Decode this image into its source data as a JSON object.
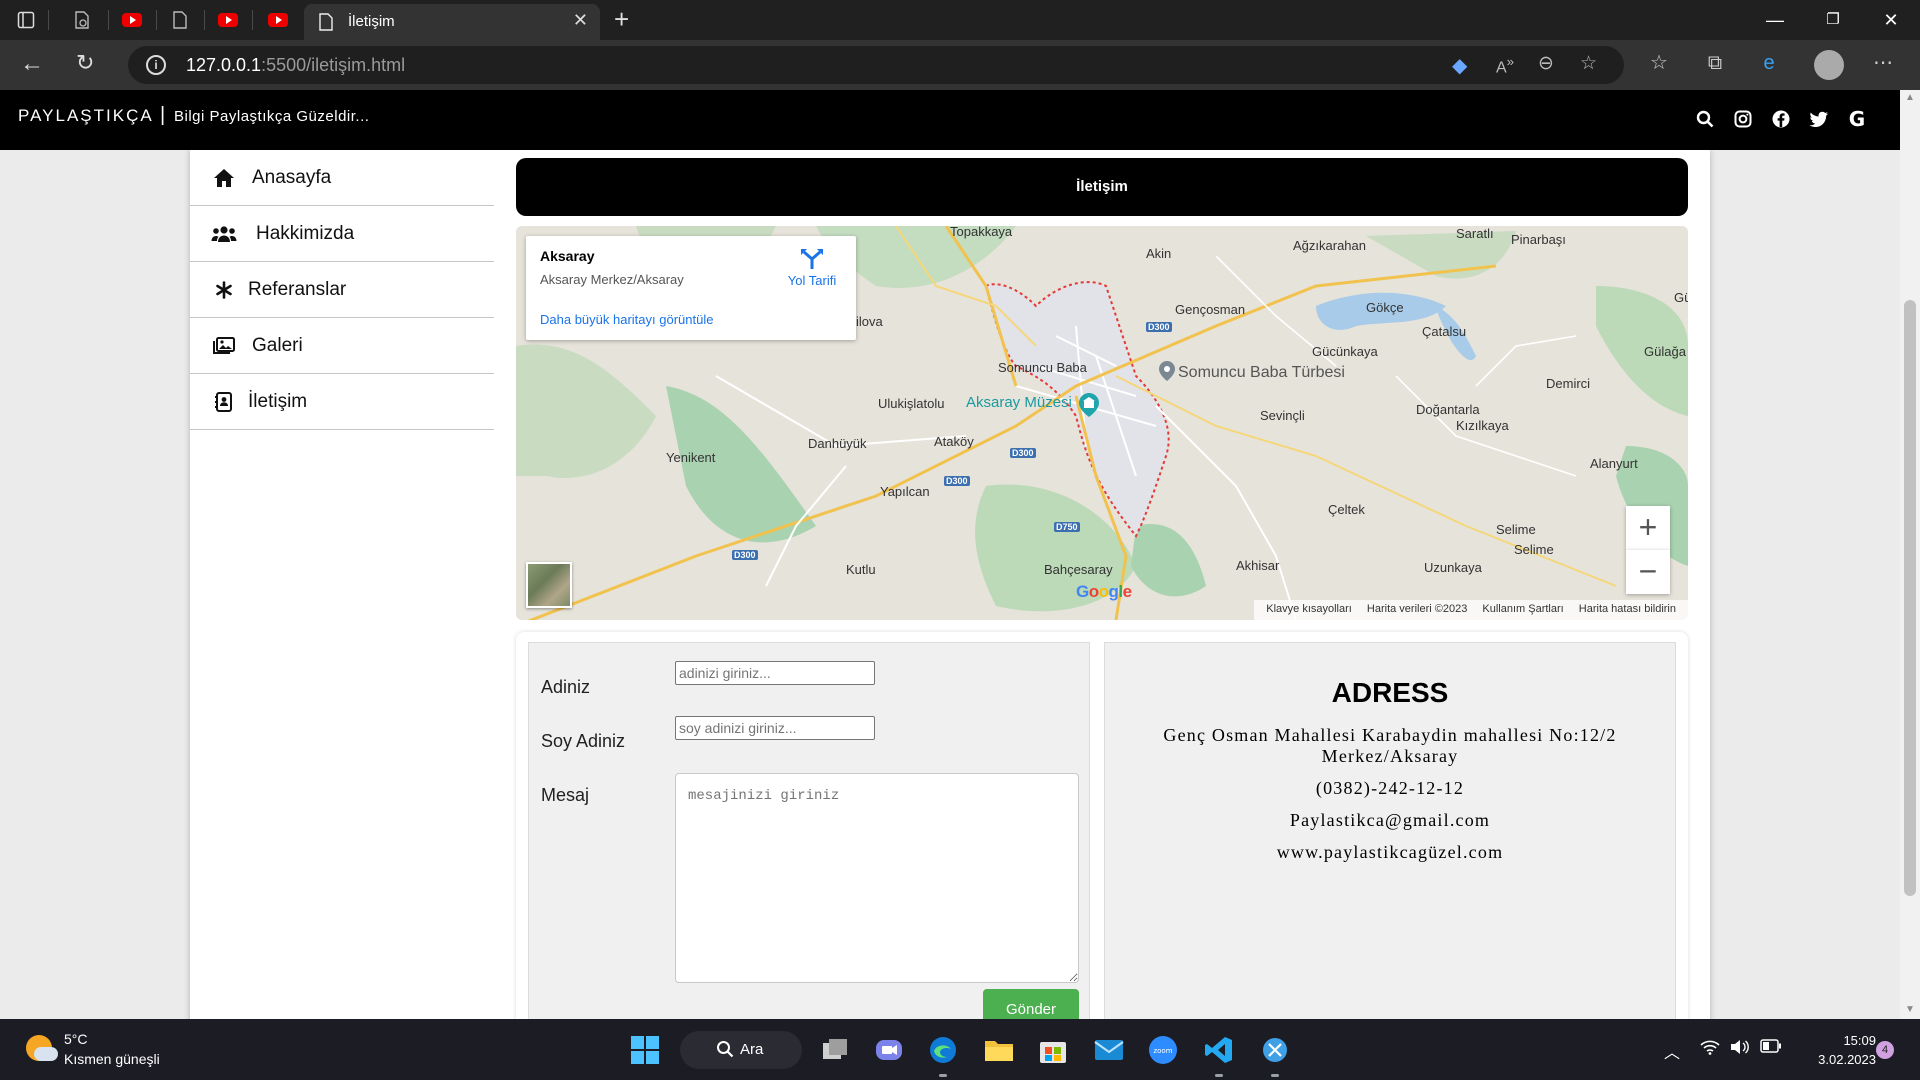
{
  "browser": {
    "active_tab_title": "İletişim",
    "url_host": "127.0.0.1",
    "url_path": ":5500/iletişim.html"
  },
  "site": {
    "brand": "PAYLAŞTIKÇA",
    "separator": "|",
    "tagline": "Bilgi Paylaştıkça Güzeldir...",
    "social_icons": [
      "search-icon",
      "instagram-icon",
      "facebook-icon",
      "twitter-icon",
      "google-icon"
    ]
  },
  "sidebar": {
    "items": [
      {
        "label": "Anasayfa",
        "icon": "home-icon"
      },
      {
        "label": "Hakkimizda",
        "icon": "users-icon"
      },
      {
        "label": "Referanslar",
        "icon": "asterisk-icon"
      },
      {
        "label": "Galeri",
        "icon": "images-icon"
      },
      {
        "label": "İletişim",
        "icon": "contact-book-icon"
      }
    ]
  },
  "page_title": "İletişim",
  "map": {
    "card": {
      "title": "Aksaray",
      "subtitle": "Aksaray Merkez/Aksaray",
      "directions": "Yol Tarifi",
      "larger_map": "Daha büyük haritayı görüntüle"
    },
    "labels": {
      "topakkaya": "Topakkaya",
      "akin": "Akin",
      "agzikarahan": "Ağzıkarahan",
      "saratli": "Saratlı",
      "pinarbasi": "Pinarbaşı",
      "gencosman": "Gençosman",
      "gokce": "Gökçe",
      "catalsu": "Çatalsu",
      "gulagac": "Gülağa",
      "gu": "Gü",
      "ilova": "ilova",
      "gucunkaya": "Gücünkaya",
      "somuncu_baba": "Somuncu Baba",
      "somuncu_baba_turbesi": "Somuncu Baba Türbesi",
      "demirci": "Demirci",
      "ulukislatolu": "Ulukişlatolu",
      "aksaray_muzesi": "Aksaray Müzesi",
      "sevincli": "Sevinçli",
      "dogantarla": "Doğantarla",
      "kizilkaya": "Kızılkaya",
      "yenikent": "Yenikent",
      "danhuyuk": "Danhüyük",
      "atakoy": "Ataköy",
      "alanyurt": "Alanyurt",
      "yapilcan": "Yapılcan",
      "celtek": "Çeltek",
      "selime1": "Selime",
      "selime2": "Selime",
      "kutlu": "Kutlu",
      "bahcesaray": "Bahçesaray",
      "akhisar": "Akhisar",
      "uzunkaya": "Uzunkaya"
    },
    "roads": {
      "r1": "D300",
      "r2": "D300",
      "r3": "D300",
      "r4": "D300",
      "r5": "D750"
    },
    "zoom_in": "+",
    "zoom_out": "−",
    "logo": "Google",
    "footer": {
      "shortcuts": "Klavye kısayolları",
      "data": "Harita verileri ©2023",
      "terms": "Kullanım Şartları",
      "report": "Harita hatası bildirin"
    }
  },
  "form": {
    "name_label": "Adiniz",
    "name_placeholder": "adinizi giriniz...",
    "surname_label": "Soy Adiniz",
    "surname_placeholder": "soy adinizi giriniz...",
    "message_label": "Mesaj",
    "message_placeholder": "mesajinizi giriniz",
    "submit": "Gönder"
  },
  "address": {
    "title": "ADRESS",
    "line1": "Genç Osman Mahallesi Karabaydin mahallesi No:12/2",
    "line2": "Merkez/Aksaray",
    "phone": "(0382)-242-12-12",
    "email": "Paylastikca@gmail.com",
    "website": "www.paylastikcagüzel.com"
  },
  "taskbar": {
    "temperature": "5°C",
    "weather": "Kısmen güneşli",
    "search_label": "Ara",
    "time": "15:09",
    "date": "3.02.2023",
    "notifications": "4"
  },
  "colors": {
    "header_bg": "#000000",
    "submit_green": "#4caf50",
    "link_blue": "#1a73e8"
  }
}
